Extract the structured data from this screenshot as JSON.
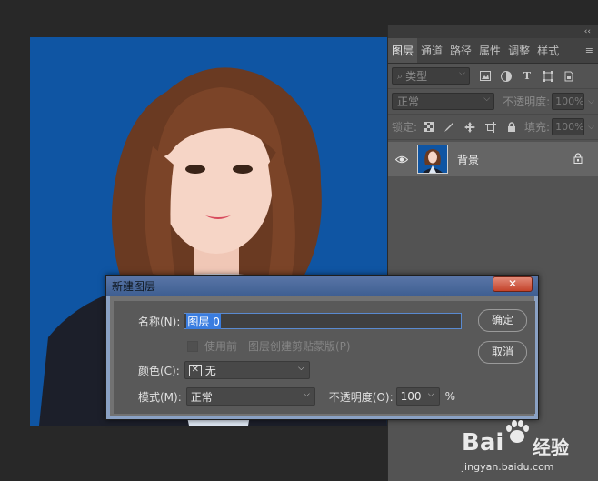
{
  "panel": {
    "collapse_glyph": "‹‹",
    "tabs": [
      "图层",
      "通道",
      "路径",
      "属性",
      "调整",
      "样式"
    ],
    "tab_menu": "≡",
    "filter": {
      "label": "类型"
    },
    "blend_mode": "正常",
    "opacity_label": "不透明度:",
    "opacity_value": "100%",
    "lock_label": "锁定:",
    "fill_label": "填充:",
    "fill_value": "100%",
    "layer": {
      "name": "背景"
    }
  },
  "dialog": {
    "title": "新建图层",
    "close": "✕",
    "name_label": "名称(N):",
    "name_value": "图层 0",
    "clip_label": "使用前一图层创建剪贴蒙版(P)",
    "color_label": "颜色(C):",
    "color_value": "无",
    "mode_label": "模式(M):",
    "mode_value": "正常",
    "opacity_label": "不透明度(O):",
    "opacity_value": "100",
    "opacity_unit": "%",
    "ok": "确定",
    "cancel": "取消"
  },
  "watermark": {
    "logo": "Bai",
    "logo_tail": "经验",
    "url": "jingyan.baidu.com"
  },
  "colors": {
    "canvas_bg": "#0f55a3",
    "panel_bg": "#535353",
    "dialog_title": "#4a6a9e",
    "close_button": "#c84a35",
    "selection": "#3a7de0"
  }
}
